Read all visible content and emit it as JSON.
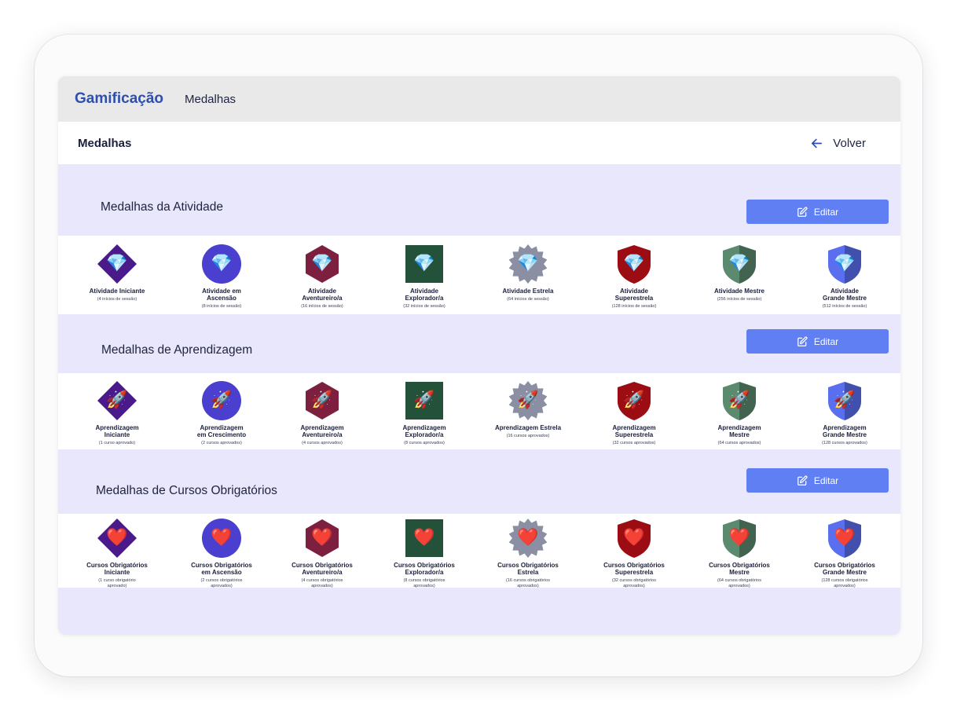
{
  "app": {
    "brand": "Gamificação",
    "breadcrumb": "Medalhas"
  },
  "page": {
    "title": "Medalhas",
    "back_label": "Volver"
  },
  "colors": {
    "brand": "#2f4fb0",
    "button": "#5f7ff2",
    "section_bg": "#e8e7fb",
    "badge_purple": "#4b1a8a",
    "badge_blue": "#4a3fcf",
    "badge_wine": "#7d1f3e",
    "badge_green": "#24513a",
    "badge_grey": "#8a8fa3",
    "badge_red": "#9b0d12",
    "badge_sage": "#5b8a6e",
    "badge_periwinkle": "#5a6ff0"
  },
  "sections": [
    {
      "title": "Medalhas da Atividade",
      "edit_label": "Editar",
      "emoji": "💎",
      "medals": [
        {
          "shape": "diamond",
          "color": "#4b1a8a",
          "name": "Atividade Iniciante",
          "sub": "(4 inícios de sessão)"
        },
        {
          "shape": "circle",
          "color": "#4a3fcf",
          "name": "Atividade em\nAscensão",
          "sub": "(8 inícios de sessão)"
        },
        {
          "shape": "hexagon",
          "color": "#7d1f3e",
          "name": "Atividade\nAventureiro/a",
          "sub": "(16 inícios de sessão)"
        },
        {
          "shape": "square",
          "color": "#24513a",
          "name": "Atividade\nExplorador/a",
          "sub": "(32 inícios de sessão)"
        },
        {
          "shape": "star",
          "color": "#8a8fa3",
          "name": "Atividade Estrela",
          "sub": "(64 inícios de sessão)"
        },
        {
          "shape": "shield",
          "color": "#9b0d12",
          "name": "Atividade\nSuperestrela",
          "sub": "(128 inícios de sessão)"
        },
        {
          "shape": "shield-split",
          "color": "#5b8a6e",
          "name": "Atividade Mestre",
          "sub": "(256 inícios de sessão)"
        },
        {
          "shape": "shield-split",
          "color": "#5a6ff0",
          "name": "Atividade\nGrande Mestre",
          "sub": "(512 inícios de sessão)"
        }
      ]
    },
    {
      "title": "Medalhas de Aprendizagem",
      "edit_label": "Editar",
      "emoji": "🚀",
      "medals": [
        {
          "shape": "diamond",
          "color": "#4b1a8a",
          "name": "Aprendizagem\nIniciante",
          "sub": "(1 curso aprovado)"
        },
        {
          "shape": "circle",
          "color": "#4a3fcf",
          "name": "Aprendizagem\nem Crescimento",
          "sub": "(2 cursos aprovados)"
        },
        {
          "shape": "hexagon",
          "color": "#7d1f3e",
          "name": "Aprendizagem\nAventureiro/a",
          "sub": "(4 cursos aprovados)"
        },
        {
          "shape": "square",
          "color": "#24513a",
          "name": "Aprendizagem\nExplorador/a",
          "sub": "(8 cursos aprovados)"
        },
        {
          "shape": "star",
          "color": "#8a8fa3",
          "name": "Aprendizagem Estrela",
          "sub": "(16 cursos aprovados)"
        },
        {
          "shape": "shield",
          "color": "#9b0d12",
          "name": "Aprendizagem\nSuperestrela",
          "sub": "(32 cursos aprovados)"
        },
        {
          "shape": "shield-split",
          "color": "#5b8a6e",
          "name": "Aprendizagem\nMestre",
          "sub": "(64 cursos aprovados)"
        },
        {
          "shape": "shield-split",
          "color": "#5a6ff0",
          "name": "Aprendizagem\nGrande Mestre",
          "sub": "(128 cursos aprovados)"
        }
      ]
    },
    {
      "title": "Medalhas de Cursos Obrigatórios",
      "edit_label": "Editar",
      "emoji": "❤️",
      "medals": [
        {
          "shape": "diamond",
          "color": "#4b1a8a",
          "name": "Cursos Obrigatórios\nIniciante",
          "sub": "(1 curso obrigatório\naprovado)"
        },
        {
          "shape": "circle",
          "color": "#4a3fcf",
          "name": "Cursos Obrigatórios\nem Ascensão",
          "sub": "(2 cursos obrigatórios\naprovados)"
        },
        {
          "shape": "hexagon",
          "color": "#7d1f3e",
          "name": "Cursos Obrigatórios\nAventureiro/a",
          "sub": "(4 cursos obrigatórios\naprovados)"
        },
        {
          "shape": "square",
          "color": "#24513a",
          "name": "Cursos Obrigatórios\nExplorador/a",
          "sub": "(8 cursos obrigatórios\naprovados)"
        },
        {
          "shape": "star",
          "color": "#8a8fa3",
          "name": "Cursos Obrigatórios\nEstrela",
          "sub": "(16 cursos obrigatórios\naprovados)"
        },
        {
          "shape": "shield",
          "color": "#9b0d12",
          "name": "Cursos Obrigatórios\nSuperestrela",
          "sub": "(32 cursos obrigatórios\naprovados)"
        },
        {
          "shape": "shield-split",
          "color": "#5b8a6e",
          "name": "Cursos Obrigatórios\nMestre",
          "sub": "(64 cursos obrigatórios\naprovados)"
        },
        {
          "shape": "shield-split",
          "color": "#5a6ff0",
          "name": "Cursos Obrigatórios\nGrande Mestre",
          "sub": "(128 cursos obrigatórios\naprovados)"
        }
      ]
    }
  ]
}
